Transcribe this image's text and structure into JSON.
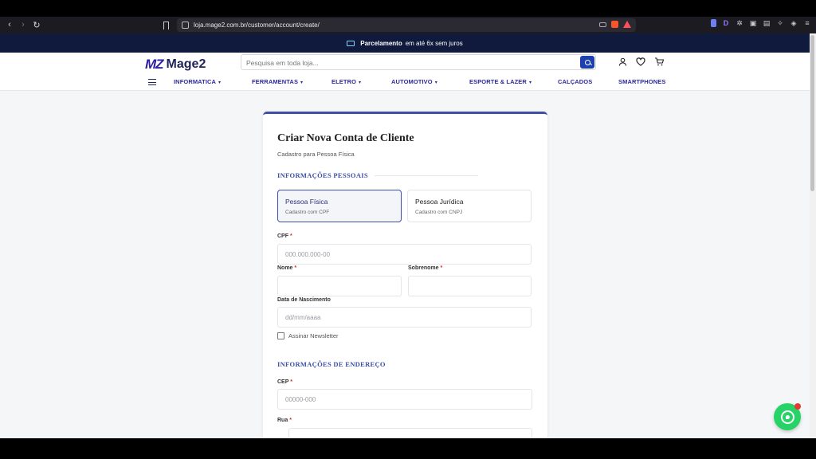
{
  "browser": {
    "url": "loja.mage2.com.br/customer/account/create/"
  },
  "promo": {
    "bold": "Parcelamento",
    "text": "em até 6x sem juros"
  },
  "header": {
    "logo_mark": "MZ",
    "logo_name": "Mage2",
    "search_placeholder": "Pesquisa em toda loja..."
  },
  "menu": {
    "items": [
      {
        "label": "INFORMATICA",
        "chevron": "▾"
      },
      {
        "label": "FERRAMENTAS",
        "chevron": "▾"
      },
      {
        "label": "ELETRO",
        "chevron": "▾"
      },
      {
        "label": "AUTOMOTIVO",
        "chevron": "▾"
      },
      {
        "label": "ESPORTE & LAZER",
        "chevron": "▾"
      },
      {
        "label": "CALÇADOS",
        "chevron": ""
      },
      {
        "label": "SMARTPHONES",
        "chevron": ""
      }
    ]
  },
  "form": {
    "title": "Criar Nova Conta de Cliente",
    "subtitle": "Cadastro para Pessoa Física",
    "section_personal": "INFORMAÇÕES PESSOAIS",
    "section_address": "INFORMAÇÕES DE ENDEREÇO",
    "person_types": [
      {
        "title": "Pessoa Física",
        "sub": "Cadastro com CPF"
      },
      {
        "title": "Pessoa Jurídica",
        "sub": "Cadastro com CNPJ"
      }
    ],
    "required_mark": "*",
    "cpf": {
      "label": "CPF",
      "placeholder": "000.000.000-00"
    },
    "nome": {
      "label": "Nome",
      "placeholder": ""
    },
    "sobrenome": {
      "label": "Sobrenome",
      "placeholder": ""
    },
    "nascimento": {
      "label": "Data de Nascimento",
      "placeholder": "dd/mm/aaaa"
    },
    "newsletter": {
      "label": "Assinar Newsletter"
    },
    "cep": {
      "label": "CEP",
      "placeholder": "00000-000"
    },
    "rua": {
      "label": "Rua",
      "placeholder": ""
    }
  },
  "colors": {
    "accent": "#3d4fa8",
    "promo_bg": "#0f1a3d",
    "search_btn": "#1e3fae",
    "whatsapp": "#25d366"
  }
}
